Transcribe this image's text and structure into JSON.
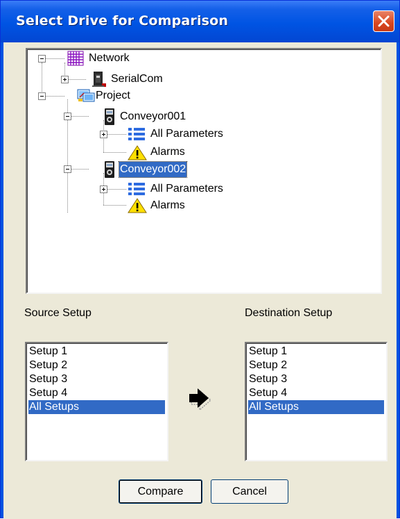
{
  "window": {
    "title": "Select Drive for Comparison",
    "close_icon": "close-icon"
  },
  "tree": {
    "nodes": [
      {
        "id": "network",
        "label": "Network",
        "icon": "network-grid-icon"
      },
      {
        "id": "serialcom",
        "label": "SerialCom",
        "icon": "serial-port-icon"
      },
      {
        "id": "project",
        "label": "Project",
        "icon": "project-icon"
      },
      {
        "id": "conveyor001",
        "label": "Conveyor001",
        "icon": "drive-icon"
      },
      {
        "id": "all-params-1",
        "label": "All Parameters",
        "icon": "parameter-list-icon"
      },
      {
        "id": "alarms-1",
        "label": "Alarms",
        "icon": "warning-icon"
      },
      {
        "id": "conveyor002",
        "label": "Conveyor002",
        "icon": "drive-icon",
        "selected": true
      },
      {
        "id": "all-params-2",
        "label": "All Parameters",
        "icon": "parameter-list-icon"
      },
      {
        "id": "alarms-2",
        "label": "Alarms",
        "icon": "warning-icon"
      }
    ]
  },
  "source": {
    "label": "Source Setup",
    "items": [
      "Setup 1",
      "Setup 2",
      "Setup 3",
      "Setup 4",
      "All Setups"
    ],
    "selected": "All Setups"
  },
  "destination": {
    "label": "Destination Setup",
    "items": [
      "Setup 1",
      "Setup 2",
      "Setup 3",
      "Setup 4",
      "All Setups"
    ],
    "selected": "All Setups"
  },
  "arrow_icon": "right-arrow-icon",
  "buttons": {
    "compare": "Compare",
    "cancel": "Cancel"
  },
  "colors": {
    "titlebar": "#0054e3",
    "selection": "#316ac5",
    "dialog_bg": "#ece9d8",
    "close_button": "#d9461f"
  }
}
